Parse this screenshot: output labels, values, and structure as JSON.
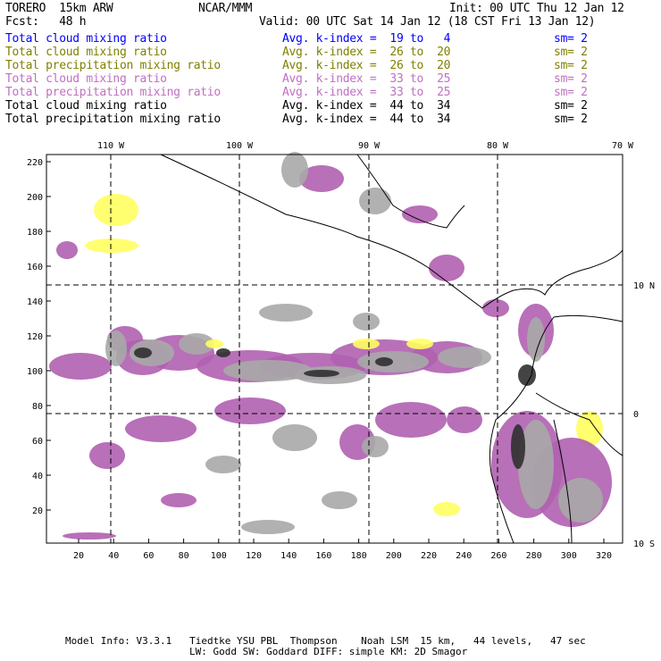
{
  "header": {
    "model": "TORERO  15km ARW",
    "org": "NCAR/MMM",
    "init": "Init: 00 UTC Thu 12 Jan 12",
    "fcst": "Fcst:   48 h",
    "valid": "Valid: 00 UTC Sat 14 Jan 12 (18 CST Fri 13 Jan 12)"
  },
  "legend": [
    {
      "field": "Total cloud mixing ratio",
      "kindex": "Avg. k-index =  19 to   4",
      "sm": "sm= 2",
      "color": "#0000ff"
    },
    {
      "field": "Total cloud mixing ratio",
      "kindex": "Avg. k-index =  26 to  20",
      "sm": "sm= 2",
      "color": "#808000"
    },
    {
      "field": "Total precipitation mixing ratio",
      "kindex": "Avg. k-index =  26 to  20",
      "sm": "sm= 2",
      "color": "#808000"
    },
    {
      "field": "Total cloud mixing ratio",
      "kindex": "Avg. k-index =  33 to  25",
      "sm": "sm= 2",
      "color": "#c070c0"
    },
    {
      "field": "Total precipitation mixing ratio",
      "kindex": "Avg. k-index =  33 to  25",
      "sm": "sm= 2",
      "color": "#c070c0"
    },
    {
      "field": "Total cloud mixing ratio",
      "kindex": "Avg. k-index =  44 to  34",
      "sm": "sm= 2",
      "color": "#000000"
    },
    {
      "field": "Total precipitation mixing ratio",
      "kindex": "Avg. k-index =  44 to  34",
      "sm": "sm= 2",
      "color": "#000000"
    }
  ],
  "chart_data": {
    "type": "heatmap",
    "title": "Total cloud / precipitation mixing ratio by k-index",
    "x_ticks": [
      "20",
      "40",
      "60",
      "80",
      "100",
      "120",
      "140",
      "160",
      "180",
      "200",
      "220",
      "240",
      "260",
      "280",
      "300",
      "320"
    ],
    "y_ticks": [
      "20",
      "40",
      "60",
      "80",
      "100",
      "120",
      "140",
      "160",
      "180",
      "200",
      "220"
    ],
    "lon_labels": [
      "110 W",
      "100 W",
      "90 W",
      "80 W",
      "70 W"
    ],
    "lat_labels": [
      "10 N",
      "0",
      "10 S"
    ],
    "xlim": [
      0,
      330
    ],
    "ylim": [
      0,
      225
    ],
    "colors": {
      "level1": "#d8f4fc",
      "level2": "#ffff60",
      "level3": "#b060b0",
      "level4": "#a8a8a8",
      "level5": "#303030"
    }
  },
  "footer": {
    "line1": "Model Info: V3.3.1   Tiedtke YSU PBL  Thompson    Noah LSM  15 km,   44 levels,   47 sec",
    "line2": "LW: Godd SW: Goddard DIFF: simple KM: 2D Smagor"
  }
}
